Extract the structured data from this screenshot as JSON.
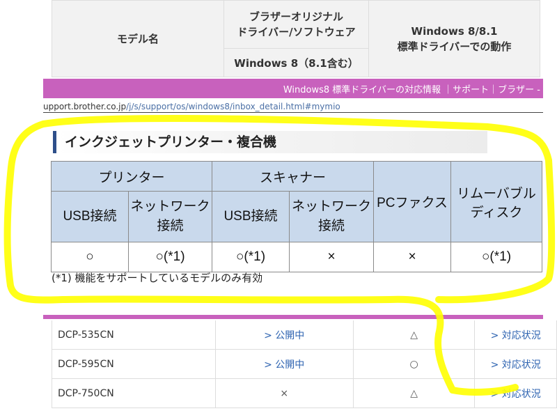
{
  "top_header": {
    "model_col": "モデル名",
    "original_line1": "ブラザーオリジナル",
    "original_line2": "ドライバー/ソフトウェア",
    "win8_sub": "Windows 8（8.1含む）",
    "std_line1": "Windows 8/8.1",
    "std_line2": "標準ドライバーでの動作"
  },
  "banner": {
    "text": "Windows8 標準ドライバーの対応情報 ｜サポート｜ブラザー -"
  },
  "url": {
    "host": "upport.brother.co.jp",
    "path": "/j/s/support/os/windows8/inbox_detail.html#mymio"
  },
  "section": {
    "title": "インクジェットプリンター・複合機"
  },
  "feature_table": {
    "group_printer": "プリンター",
    "group_scanner": "スキャナー",
    "pc_fax": "PCファクス",
    "removable_line1": "リムーバブル",
    "removable_line2": "ディスク",
    "usb": "USB接続",
    "network_line1": "ネットワーク",
    "network_line2": "接続",
    "values": [
      "○",
      "○(*1)",
      "○(*1)",
      "×",
      "×",
      "○(*1)"
    ]
  },
  "footnote": "(*1) 機能をサポートしているモデルのみ有効",
  "models": [
    {
      "name": "DCP-535CN",
      "published": "> 公開中",
      "mark": "△",
      "link": "> 対応状況"
    },
    {
      "name": "DCP-595CN",
      "published": "> 公開中",
      "mark": "○",
      "link": "> 対応状況"
    },
    {
      "name": "DCP-750CN",
      "published": "×",
      "mark": "△",
      "link": "> 対応状況"
    }
  ],
  "colors": {
    "banner": "#c861bd",
    "table_header": "#c9d9ec",
    "link": "#2c62b0",
    "highlight": "#ffff00"
  }
}
